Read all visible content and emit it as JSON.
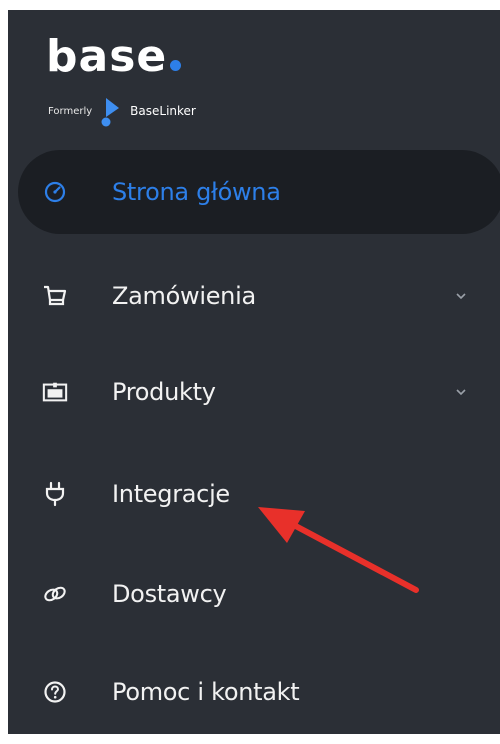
{
  "brand": {
    "name": "base",
    "formerly_label": "Formerly",
    "former_name": "BaseLinker",
    "accent_color": "#2d7fe8"
  },
  "nav": {
    "items": [
      {
        "label": "Strona główna",
        "icon": "dashboard-icon",
        "active": true,
        "expandable": false
      },
      {
        "label": "Zamówienia",
        "icon": "cart-icon",
        "active": false,
        "expandable": true
      },
      {
        "label": "Produkty",
        "icon": "products-icon",
        "active": false,
        "expandable": true
      },
      {
        "label": "Integracje",
        "icon": "plug-icon",
        "active": false,
        "expandable": false
      },
      {
        "label": "Dostawcy",
        "icon": "link-icon",
        "active": false,
        "expandable": false
      },
      {
        "label": "Pomoc i kontakt",
        "icon": "help-icon",
        "active": false,
        "expandable": false
      }
    ]
  },
  "annotation": {
    "arrow_color": "#e8302a",
    "points_to": "Integracje"
  }
}
